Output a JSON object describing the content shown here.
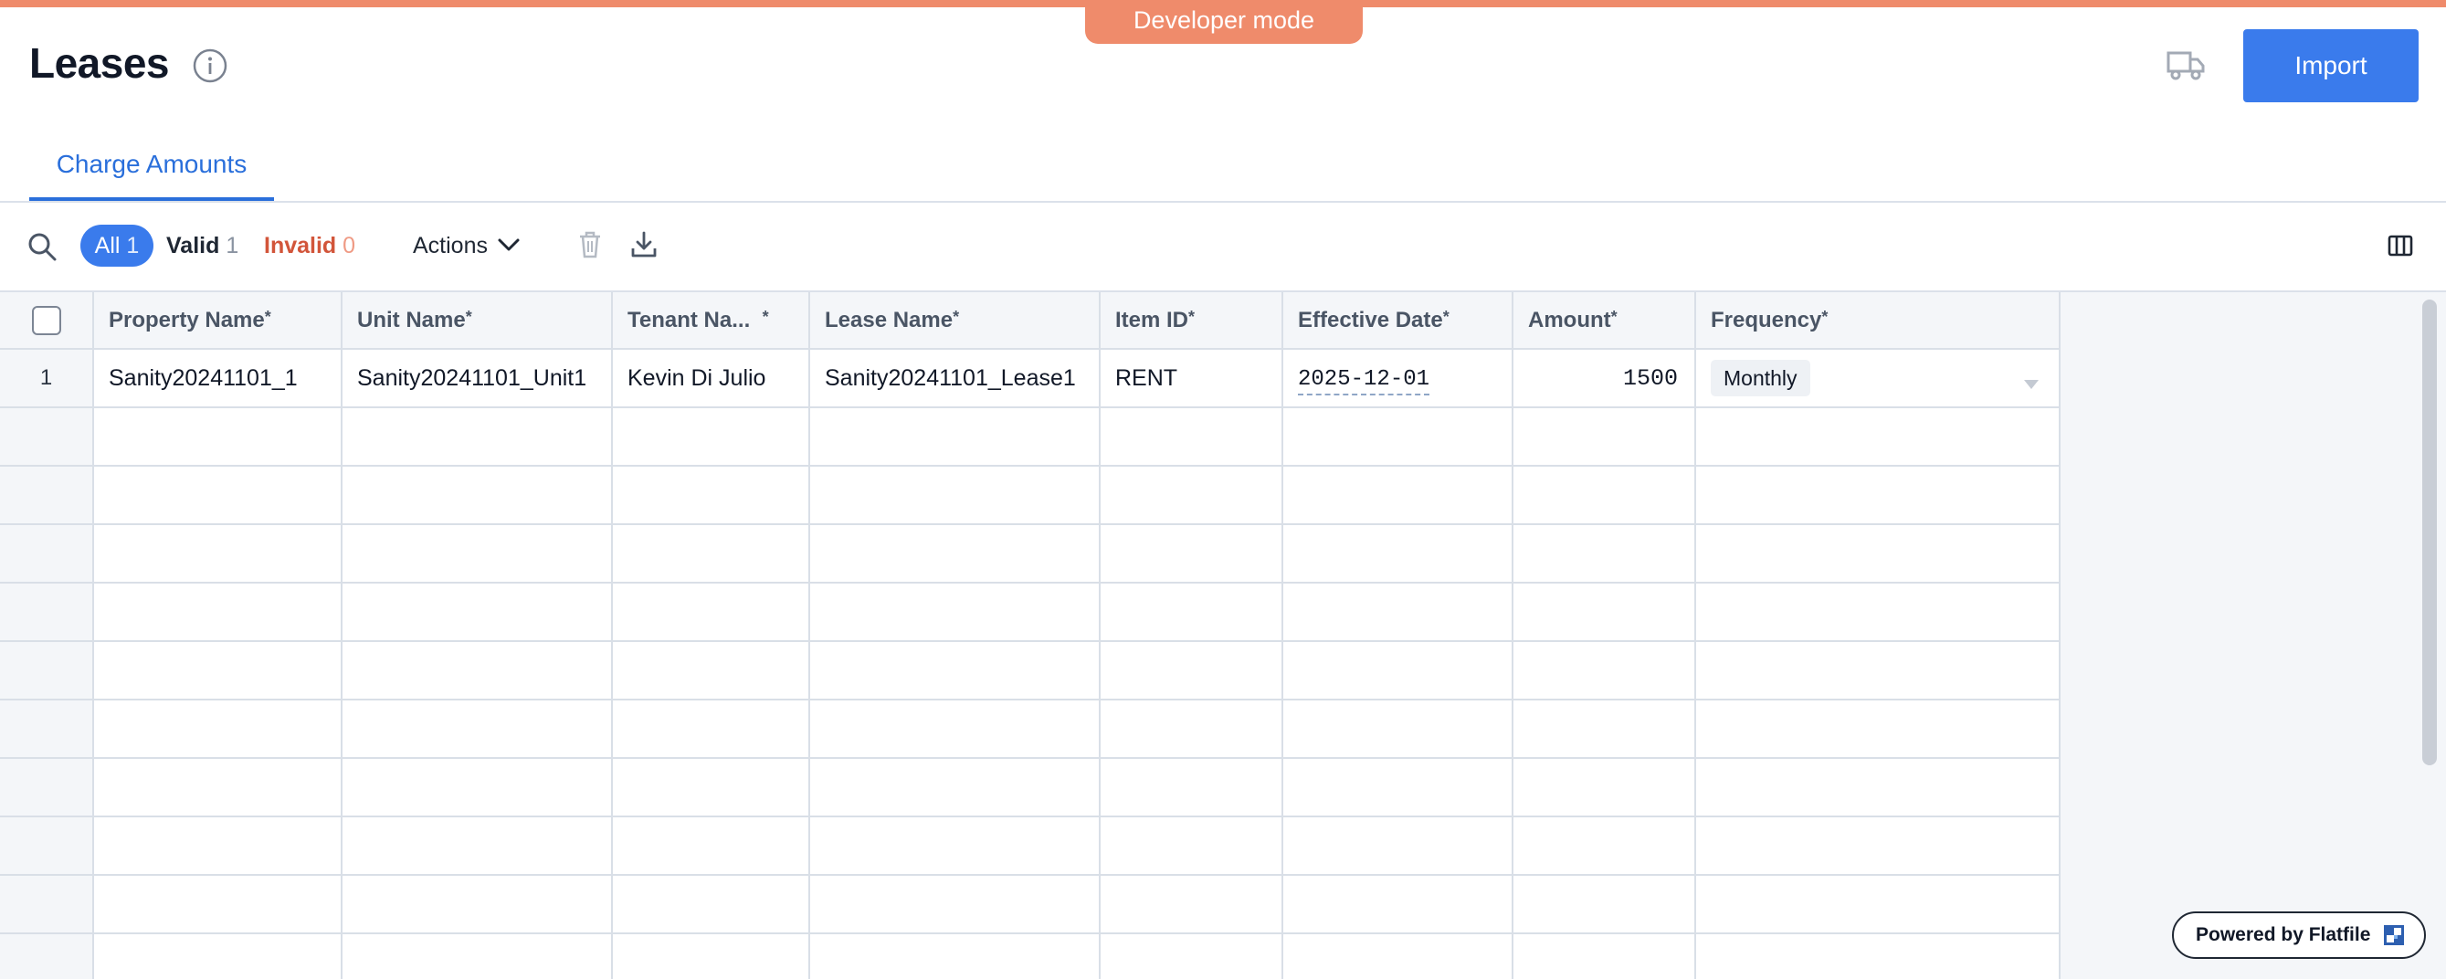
{
  "banner": {
    "dev_mode_label": "Developer mode"
  },
  "header": {
    "title": "Leases",
    "import_label": "Import"
  },
  "tabs": [
    {
      "label": "Charge Amounts",
      "active": true
    }
  ],
  "toolbar": {
    "filters": {
      "all_label": "All",
      "all_count": "1",
      "valid_label": "Valid",
      "valid_count": "1",
      "invalid_label": "Invalid",
      "invalid_count": "0"
    },
    "actions_label": "Actions"
  },
  "grid": {
    "columns": [
      {
        "label": "Property Name",
        "required": "*"
      },
      {
        "label": "Unit Name",
        "required": "*"
      },
      {
        "label": "Tenant Na...",
        "required": "*"
      },
      {
        "label": "Lease Name",
        "required": "*"
      },
      {
        "label": "Item ID",
        "required": "*"
      },
      {
        "label": "Effective Date",
        "required": "*"
      },
      {
        "label": "Amount",
        "required": "*"
      },
      {
        "label": "Frequency",
        "required": "*"
      }
    ],
    "rows": [
      {
        "index": "1",
        "property_name": "Sanity20241101_1",
        "unit_name": "Sanity20241101_Unit1",
        "tenant_name": "Kevin Di Julio",
        "lease_name": "Sanity20241101_Lease1",
        "item_id": "RENT",
        "effective_date": "2025-12-01",
        "amount": "1500",
        "frequency": "Monthly"
      }
    ]
  },
  "footer": {
    "powered_by": "Powered by Flatfile"
  },
  "colors": {
    "accent": "#3a7bec",
    "dev_banner": "#ef8b6b",
    "invalid": "#d2553a"
  }
}
